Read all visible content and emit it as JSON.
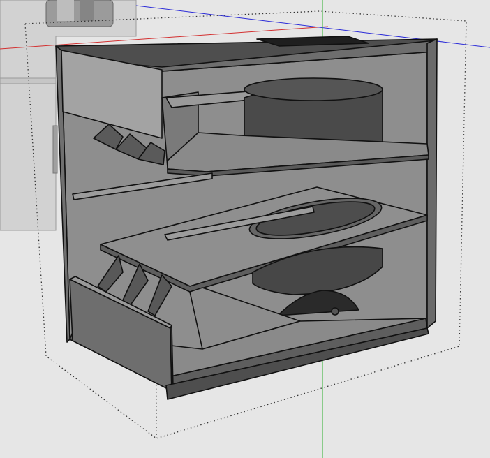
{
  "viewport": {
    "background": "#e4e4e4",
    "axes": {
      "red_axis": "#d33030",
      "blue_axis": "#2b2bd8",
      "green_axis": "#2fb02f"
    },
    "edge_color": "#111111",
    "face_colors": {
      "light": "#a3a3a3",
      "mid": "#8c8c8c",
      "dark": "#5a5a5a",
      "shadow": "#3a3a3a"
    }
  }
}
